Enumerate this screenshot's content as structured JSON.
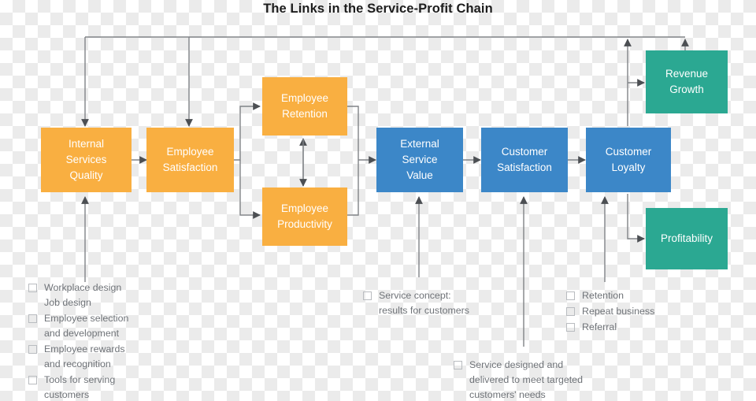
{
  "title": "The Links in the Service-Profit Chain",
  "colors": {
    "orange": "#F9AF41",
    "blue": "#3C87C8",
    "green": "#2BA892",
    "connector": "#808387",
    "checkbox_border": "#b9bcc0",
    "list_text": "#6f7378",
    "title_text": "#1d1d1d"
  },
  "nodes": [
    {
      "id": "internal-services-quality",
      "label": "Internal\nServices\nQuality",
      "color": "orange"
    },
    {
      "id": "employee-satisfaction",
      "label": "Employee\nSatisfaction",
      "color": "orange"
    },
    {
      "id": "employee-retention",
      "label": "Employee\nRetention",
      "color": "orange"
    },
    {
      "id": "employee-productivity",
      "label": "Employee\nProductivity",
      "color": "orange"
    },
    {
      "id": "external-service-value",
      "label": "External\nService\nValue",
      "color": "blue"
    },
    {
      "id": "customer-satisfaction",
      "label": "Customer\nSatisfaction",
      "color": "blue"
    },
    {
      "id": "customer-loyalty",
      "label": "Customer\nLoyalty",
      "color": "blue"
    },
    {
      "id": "revenue-growth",
      "label": "Revenue\nGrowth",
      "color": "green"
    },
    {
      "id": "profitability",
      "label": "Profitability",
      "color": "green"
    }
  ],
  "checklists": {
    "internal_quality": {
      "items": [
        "Workplace design\nJob design",
        "Employee selection\nand development",
        "Employee rewards\nand recognition",
        "Tools for serving\ncustomers"
      ]
    },
    "service_concept": {
      "items": [
        "Service concept:\nresults for customers"
      ]
    },
    "service_design": {
      "items": [
        "Service designed and\ndelivered to meet targeted\ncustomers' needs"
      ]
    },
    "loyalty_outcomes": {
      "items": [
        "Retention",
        "Repeat business",
        "Referral"
      ]
    }
  }
}
